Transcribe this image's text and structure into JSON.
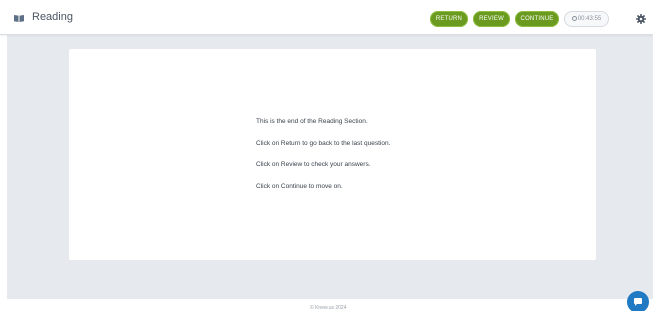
{
  "header": {
    "section_icon": "book-icon",
    "section_title": "Reading",
    "buttons": {
      "return_label": "RETURN",
      "review_label": "REVIEW",
      "continue_label": "CONTINUE"
    },
    "timer": {
      "icon": "clock-icon",
      "value": "00:43:55"
    },
    "settings_icon": "gear-icon"
  },
  "main": {
    "lines": [
      "This is the end of the Reading Section.",
      "Click on Return to go back to the last question.",
      "Click on Review to check your answers.",
      "Click on Continue to move on."
    ]
  },
  "footer": {
    "text": "© Knew.us 2024"
  },
  "chat": {
    "icon": "chat-icon"
  },
  "colors": {
    "accent_green": "#6a9a1f",
    "background_gray": "#e6e9ee",
    "chat_blue": "#1f7ac3"
  }
}
